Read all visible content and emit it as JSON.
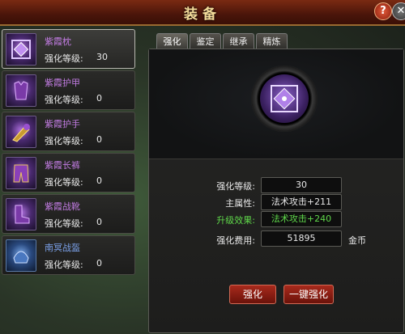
{
  "window": {
    "title": "装备"
  },
  "titlebar": {
    "help_glyph": "?",
    "close_glyph": "✕"
  },
  "items": [
    {
      "name": "紫霞枕",
      "level_label": "强化等级:",
      "level": "30",
      "color": "purple",
      "selected": true,
      "icon": "amulet-icon"
    },
    {
      "name": "紫霞护甲",
      "level_label": "强化等级:",
      "level": "0",
      "color": "purple",
      "selected": false,
      "icon": "armor-icon"
    },
    {
      "name": "紫霞护手",
      "level_label": "强化等级:",
      "level": "0",
      "color": "purple",
      "selected": false,
      "icon": "gauntlet-icon"
    },
    {
      "name": "紫霞长裤",
      "level_label": "强化等级:",
      "level": "0",
      "color": "purple",
      "selected": false,
      "icon": "pants-icon"
    },
    {
      "name": "紫霞战靴",
      "level_label": "强化等级:",
      "level": "0",
      "color": "purple",
      "selected": false,
      "icon": "boots-icon"
    },
    {
      "name": "南冥战盔",
      "level_label": "强化等级:",
      "level": "0",
      "color": "blue",
      "selected": false,
      "icon": "helmet-icon"
    }
  ],
  "tabs": [
    "强化",
    "鉴定",
    "继承",
    "精炼"
  ],
  "active_tab": 0,
  "details": {
    "level_label": "强化等级:",
    "level": "30",
    "attr_label": "主属性:",
    "attr_value": "法术攻击+211",
    "upgrade_label": "升级效果:",
    "upgrade_value": "法术攻击+240",
    "cost_label": "强化费用:",
    "cost_value": "51895",
    "cost_unit": "金币"
  },
  "buttons": {
    "enhance": "强化",
    "one_click": "一键强化"
  },
  "colors": {
    "purple": "#c07be0",
    "blue": "#7aa0e8",
    "green": "#5fd84a",
    "button": "#a82a1c"
  }
}
